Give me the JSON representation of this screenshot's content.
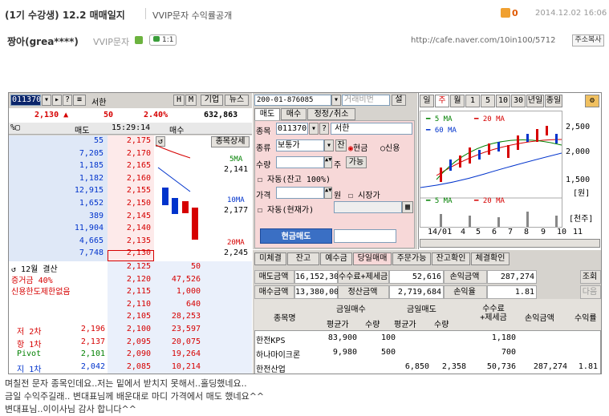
{
  "header": {
    "title": "(1기 수강생) 12.2 매매일지",
    "subtitle": "VVIP문자 수익률공개",
    "likes": "0",
    "date": "2014.12.02 16:06"
  },
  "author": {
    "name": "짱아(grea****)",
    "grade": "VVIP문자",
    "comments": "1:1",
    "url": "http://cafe.naver.com/10in100/5712",
    "copy_label": "주소복사"
  },
  "hts": {
    "left": {
      "code": "011370",
      "name": "서한",
      "btns": [
        "H",
        "M",
        "기업",
        "뉴스"
      ],
      "price": "2,130",
      "arrow": "▲",
      "change": "50",
      "rate": "2.40%",
      "volume": "632,863",
      "col_sell": "매도",
      "time": "15:29:14",
      "col_buy": "매수",
      "asks": [
        {
          "qty": "55",
          "price": "2,175"
        },
        {
          "qty": "7,205",
          "price": "2,170"
        },
        {
          "qty": "1,185",
          "price": "2,165"
        },
        {
          "qty": "1,182",
          "price": "2,160"
        },
        {
          "qty": "12,915",
          "price": "2,155"
        },
        {
          "qty": "1,652",
          "price": "2,150"
        },
        {
          "qty": "389",
          "price": "2,145"
        },
        {
          "qty": "11,904",
          "price": "2,140"
        },
        {
          "qty": "4,665",
          "price": "2,135"
        },
        {
          "qty": "7,748",
          "price": "2,130"
        }
      ],
      "bids": [
        {
          "price": "2,125",
          "qty": "50"
        },
        {
          "price": "2,120",
          "qty": "47,526"
        },
        {
          "price": "2,115",
          "qty": "1,000"
        },
        {
          "price": "2,110",
          "qty": "640"
        },
        {
          "price": "2,105",
          "qty": "28,253"
        },
        {
          "price": "2,100",
          "qty": "23,597"
        },
        {
          "price": "2,095",
          "qty": "20,075"
        },
        {
          "price": "2,090",
          "qty": "19,264"
        },
        {
          "price": "2,085",
          "qty": "10,214"
        }
      ],
      "detail_btn": "종목상세",
      "ma5": "5MA",
      "ma5v": "2,141",
      "ma10": "10MA",
      "ma10v": "2,177",
      "ma20": "20MA",
      "ma20v": "2,245",
      "settle": "12월 결산",
      "margin": "증거금 40%",
      "credit": "신용한도제한없음",
      "pivots": [
        {
          "label": "저 2차",
          "val": "2,196"
        },
        {
          "label": "항 1차",
          "val": "2,137"
        },
        {
          "label": "Pivot",
          "val": "2,101"
        },
        {
          "label": "지 1차",
          "val": "2,042"
        }
      ]
    },
    "order": {
      "account": "200-01-876085",
      "pw": "거래비번",
      "set": "설",
      "tabs": [
        "매도",
        "매수",
        "정정/취소"
      ],
      "code_lbl": "종목",
      "code": "011370",
      "name": "서한",
      "type_lbl": "종류",
      "type": "보통가",
      "jan": "잔",
      "cash": "현금",
      "credit": "신용",
      "qty_lbl": "수량",
      "q_btn": "주",
      "avail": "가능",
      "auto1": "자동(잔고 100%)",
      "price_lbl": "가격",
      "won": "원",
      "market": "시장가",
      "auto2": "자동(현재가)",
      "submit": "현금매도"
    },
    "chart": {
      "tabs": [
        "일",
        "주",
        "월",
        "1",
        "5",
        "10",
        "30",
        "년일",
        "종일"
      ],
      "ma5": "5 MA",
      "ma20": "20 MA",
      "ma60": "60 MA",
      "y": [
        "2,500",
        "2,000",
        "1,500"
      ],
      "unit1": "[원]",
      "ma5b": "5 MA",
      "ma20b": "20 MA",
      "unit2": "[천주]",
      "x": [
        "14/01",
        "4",
        "5",
        "6",
        "7",
        "8",
        "9",
        "10",
        "11"
      ]
    },
    "balance": {
      "tabs": [
        "미체결",
        "잔고",
        "예수금",
        "당일매매",
        "주문가능",
        "잔고확인",
        "체결확인"
      ],
      "r1": [
        "매도금액",
        "16,152,300",
        "수수료+제세금",
        "52,616",
        "손익금액",
        "287,274",
        "조회"
      ],
      "r2": [
        "매수금액",
        "13,380,000",
        "정산금액",
        "2,719,684",
        "손익율",
        "1.81",
        "다음"
      ],
      "head": {
        "name": "종목명",
        "buy": "금일매수",
        "sell": "금일매도",
        "fee": "수수료 +제세금",
        "pl": "손익금액",
        "rate": "수익률",
        "avg": "평균가",
        "qty": "수량"
      },
      "rows": [
        {
          "name": "한전KPS",
          "bavg": "83,900",
          "bqty": "100",
          "savg": "",
          "sqty": "",
          "fee": "1,180",
          "pl": "",
          "rate": ""
        },
        {
          "name": "하나마이크론",
          "bavg": "9,980",
          "bqty": "500",
          "savg": "",
          "sqty": "",
          "fee": "700",
          "pl": "",
          "rate": ""
        },
        {
          "name": "한전산업",
          "bavg": "",
          "bqty": "",
          "savg": "6,850",
          "sqty": "2,358",
          "fee": "50,736",
          "pl": "287,274",
          "rate": "1.81"
        }
      ]
    }
  },
  "body": {
    "lines": [
      "며칠전 문자 종목인데요..저는 밑에서 받치지 못해서..홀딩했네요..",
      "금일 수익주길래.. 변대표님께 배운대로 마디 가격에서 매도 했네요^^",
      "변대표님..이이사님 감사 합니다^^"
    ]
  }
}
